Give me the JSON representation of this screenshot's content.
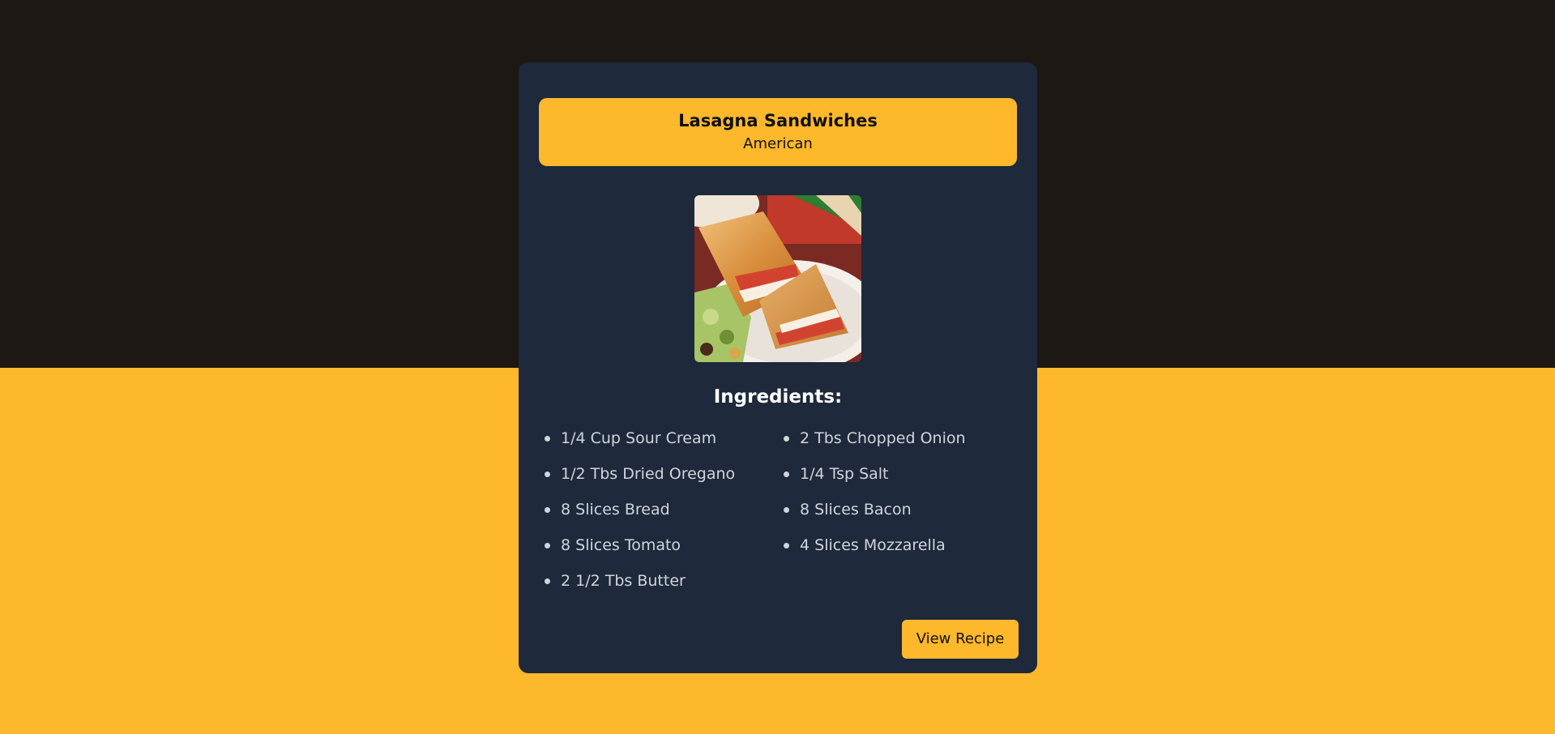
{
  "recipe": {
    "title": "Lasagna Sandwiches",
    "cuisine": "American",
    "ingredients_heading": "Ingredients:",
    "ingredients": [
      "1/4 Cup Sour Cream",
      "2 Tbs Chopped Onion",
      "1/2 Tbs Dried Oregano",
      "1/4 Tsp Salt",
      "8 Slices Bread",
      "8 Slices Bacon",
      "8 Slices Tomato",
      "4 Slices Mozzarella",
      "2 1/2 Tbs Butter"
    ],
    "button_label": "View Recipe"
  },
  "colors": {
    "page_top": "#1d1814",
    "page_bottom": "#fdb82b",
    "card": "#1e293b",
    "accent": "#fdb82b",
    "heading_text": "#ffffff",
    "ingredient_text": "#d1d5db"
  }
}
